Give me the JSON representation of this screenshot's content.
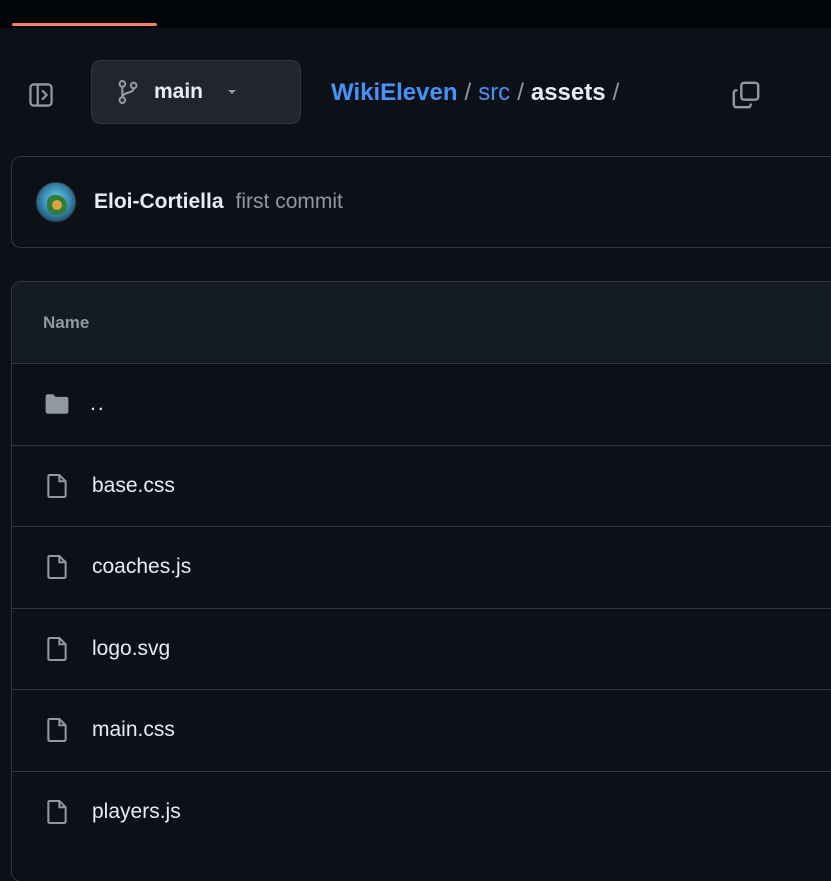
{
  "branch": {
    "name": "main"
  },
  "breadcrumb": {
    "repo": "WikiEleven",
    "separator": "/",
    "folder": "src",
    "current": "assets",
    "trailing": "/"
  },
  "commit": {
    "author": "Eloi-Cortiella",
    "message": "first commit"
  },
  "file_table": {
    "header": "Name",
    "parent": "..",
    "files": [
      {
        "name": "base.css"
      },
      {
        "name": "coaches.js"
      },
      {
        "name": "logo.svg"
      },
      {
        "name": "main.css"
      },
      {
        "name": "players.js"
      }
    ]
  },
  "colors": {
    "background": "#0d1117",
    "link": "#4493f8",
    "border": "#30363d",
    "progress": "#f78166",
    "muted": "#9198a1"
  },
  "icons": {
    "sidebar": "sidebar-expand-icon",
    "branch": "git-branch-icon",
    "caret": "triangle-down-icon",
    "copy": "copy-icon",
    "folder": "folder-icon",
    "file": "file-icon"
  }
}
